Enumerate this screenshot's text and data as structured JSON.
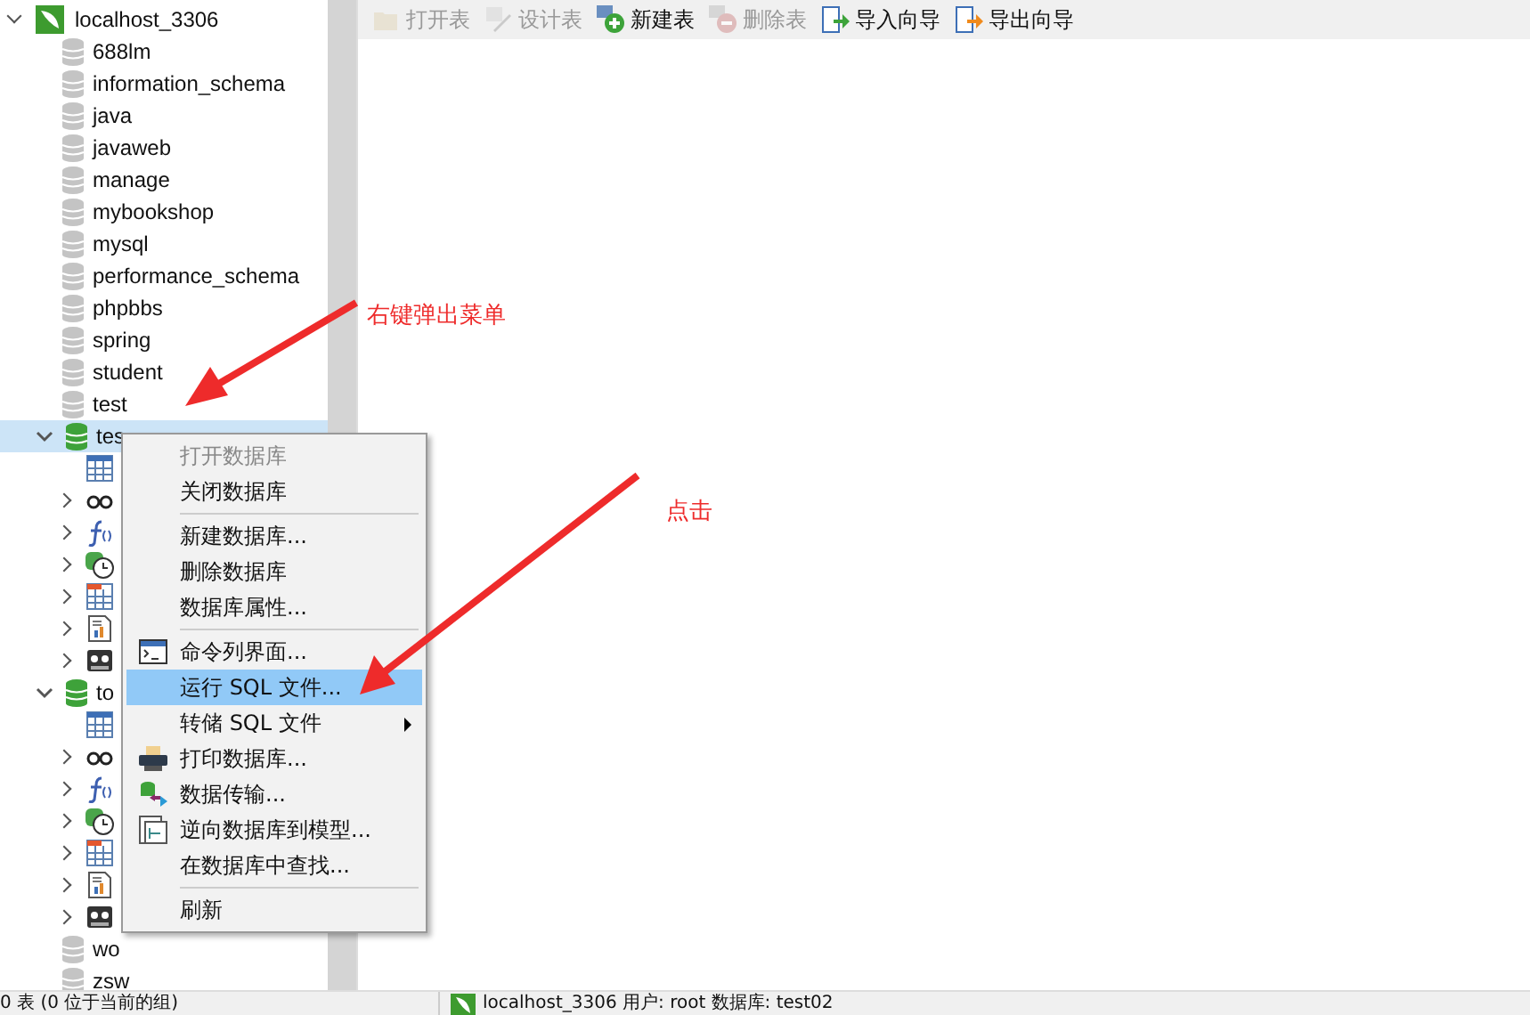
{
  "tree": {
    "connection": {
      "label": "localhost_3306",
      "expanded": true
    },
    "databases": [
      {
        "label": "688lm",
        "open": false,
        "selected": false
      },
      {
        "label": "information_schema",
        "open": false,
        "selected": false
      },
      {
        "label": "java",
        "open": false,
        "selected": false
      },
      {
        "label": "javaweb",
        "open": false,
        "selected": false
      },
      {
        "label": "manage",
        "open": false,
        "selected": false
      },
      {
        "label": "mybookshop",
        "open": false,
        "selected": false
      },
      {
        "label": "mysql",
        "open": false,
        "selected": false
      },
      {
        "label": "performance_schema",
        "open": false,
        "selected": false
      },
      {
        "label": "phpbbs",
        "open": false,
        "selected": false
      },
      {
        "label": "spring",
        "open": false,
        "selected": false
      },
      {
        "label": "student",
        "open": false,
        "selected": false
      },
      {
        "label": "test",
        "open": false,
        "selected": false
      },
      {
        "label": "tes",
        "open": true,
        "expanded": true,
        "selected": true,
        "children": [
          {
            "kind": "tables"
          },
          {
            "kind": "views"
          },
          {
            "kind": "functions"
          },
          {
            "kind": "events"
          },
          {
            "kind": "queries"
          },
          {
            "kind": "reports"
          },
          {
            "kind": "backups"
          }
        ]
      },
      {
        "label": "to",
        "open": true,
        "expanded": true,
        "selected": false,
        "children": [
          {
            "kind": "tables"
          },
          {
            "kind": "views"
          },
          {
            "kind": "functions"
          },
          {
            "kind": "events"
          },
          {
            "kind": "queries"
          },
          {
            "kind": "reports"
          },
          {
            "kind": "backups"
          }
        ]
      },
      {
        "label": "wo",
        "open": false,
        "selected": false
      },
      {
        "label": "zsw",
        "open": false,
        "selected": false
      }
    ]
  },
  "toolbar": [
    {
      "label": "打开表",
      "kind": "open",
      "disabled": true
    },
    {
      "label": "设计表",
      "kind": "design",
      "disabled": true
    },
    {
      "label": "新建表",
      "kind": "new",
      "disabled": false
    },
    {
      "label": "删除表",
      "kind": "delete",
      "disabled": true
    },
    {
      "label": "导入向导",
      "kind": "import",
      "disabled": false
    },
    {
      "label": "导出向导",
      "kind": "export",
      "disabled": false
    }
  ],
  "context_menu": {
    "items": [
      {
        "kind": "item",
        "label": "打开数据库",
        "disabled": true,
        "selected": false
      },
      {
        "kind": "item",
        "label": "关闭数据库",
        "disabled": false,
        "selected": false
      },
      {
        "kind": "separator"
      },
      {
        "kind": "item",
        "label": "新建数据库...",
        "disabled": false,
        "selected": false
      },
      {
        "kind": "item",
        "label": "删除数据库",
        "disabled": false,
        "selected": false
      },
      {
        "kind": "item",
        "label": "数据库属性...",
        "disabled": false,
        "selected": false
      },
      {
        "kind": "separator"
      },
      {
        "kind": "console",
        "label": "命令列界面...",
        "disabled": false,
        "selected": false
      },
      {
        "kind": "item",
        "label": "运行 SQL 文件...",
        "disabled": false,
        "selected": true
      },
      {
        "kind": "submenu",
        "label": "转储 SQL 文件",
        "disabled": false,
        "selected": false
      },
      {
        "kind": "printer",
        "label": "打印数据库...",
        "disabled": false,
        "selected": false
      },
      {
        "kind": "transfer",
        "label": "数据传输...",
        "disabled": false,
        "selected": false
      },
      {
        "kind": "model",
        "label": "逆向数据库到模型...",
        "disabled": false,
        "selected": false
      },
      {
        "kind": "item",
        "label": "在数据库中查找...",
        "disabled": false,
        "selected": false
      },
      {
        "kind": "separator"
      },
      {
        "kind": "item",
        "label": "刷新",
        "disabled": false,
        "selected": false
      }
    ]
  },
  "annotations": [
    {
      "text": "右键弹出菜单"
    },
    {
      "text": "点击"
    }
  ],
  "status_bar": {
    "left": "0 表 (0 位于当前的组)",
    "right": "localhost_3306   用户: root   数据库: test02"
  }
}
